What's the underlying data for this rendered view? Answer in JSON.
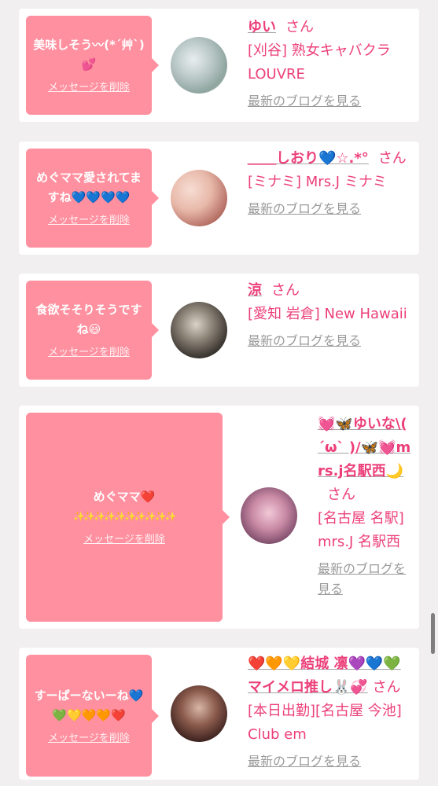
{
  "delete_label": "メッセージを削除",
  "blog_label": "最新のブログを見る",
  "cards": [
    {
      "message": "美味しそう〰(*´艸`)💕",
      "name": "ゆい",
      "suffix": "さん",
      "shop": "[刈谷] 熟女キャバクラLOUVRE"
    },
    {
      "message": "めぐママ愛されてますね💙💙💙💙",
      "name": "＿＿しおり💙☆.*°",
      "suffix": "さん",
      "shop": "[ミナミ] Mrs.J ミナミ"
    },
    {
      "message": "食欲そそりそうですね😃",
      "name": "涼",
      "suffix": "さん",
      "shop": "[愛知 岩倉] New Hawaii"
    },
    {
      "message": "めぐママ❤️",
      "message2": "✨✨✨✨✨✨✨✨✨✨",
      "name": "💓🦋ゆいな\\( ´ω` )/🦋💓mrs.j名駅西🌙",
      "suffix": "さん",
      "shop": "[名古屋 名駅] mrs.J 名駅西"
    },
    {
      "message": "すーぱーないーね💙💚💛🧡🧡❤️",
      "name": "❤️🧡💛結城 凛💜💙💚マイメロ推し🐰💞",
      "suffix": "さん",
      "shop": "[本日出勤][名古屋 今池] Club em"
    }
  ]
}
